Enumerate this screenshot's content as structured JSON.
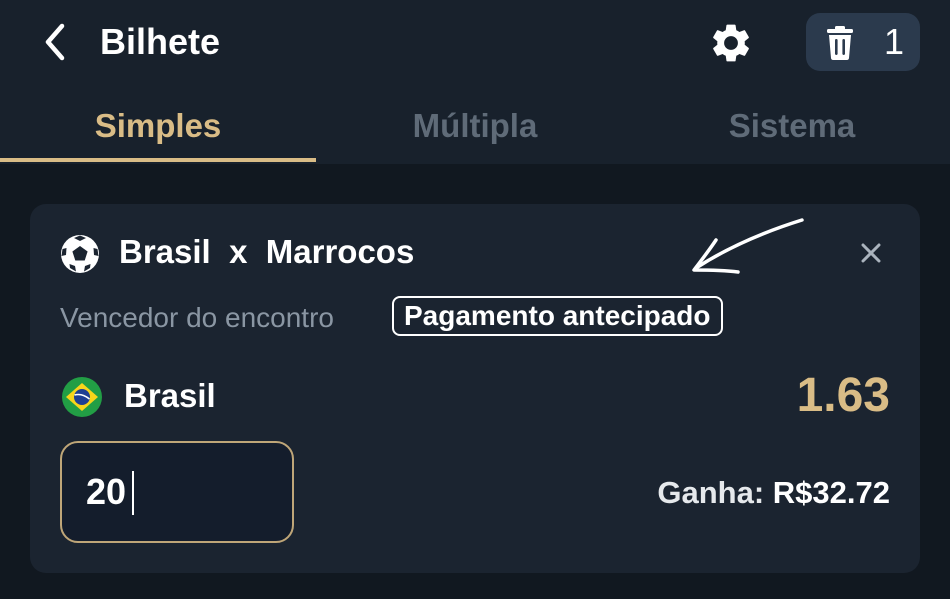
{
  "header": {
    "title": "Bilhete",
    "trash_count": "1"
  },
  "tabs": [
    {
      "label": "Simples",
      "active": true
    },
    {
      "label": "Múltipla",
      "active": false
    },
    {
      "label": "Sistema",
      "active": false
    }
  ],
  "bet": {
    "home_team": "Brasil",
    "separator": "x",
    "away_team": "Marrocos",
    "market": "Vencedor do encontro",
    "badge": "Pagamento antecipado",
    "selection": "Brasil",
    "odds": "1.63",
    "stake": "20",
    "win_label": "Ganha:",
    "win_amount": "R$32.72"
  },
  "colors": {
    "accent": "#d9bc86",
    "background": "#111820",
    "header": "#18212c",
    "card": "#1b2430",
    "muted": "#5f6b78"
  },
  "icons": [
    "back-arrow-icon",
    "gear-icon",
    "trash-icon",
    "soccer-ball-icon",
    "close-icon",
    "brazil-flag-icon",
    "annotation-arrow"
  ]
}
